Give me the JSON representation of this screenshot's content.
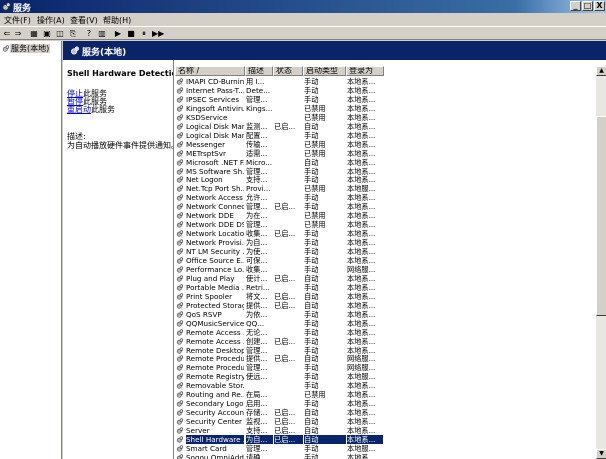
{
  "window": {
    "title": "服务",
    "minimize": "_",
    "maximize": "□",
    "close": "X"
  },
  "menu": [
    "文件(F)",
    "操作(A)",
    "查看(V)",
    "帮助(H)"
  ],
  "toolbar": [
    "⇐",
    "⇒",
    "▦",
    "▣",
    "◫",
    "⎘",
    "?",
    "▥",
    "▶",
    "■",
    "⏸",
    "▶▶"
  ],
  "tree": {
    "root": "服务(本地)"
  },
  "header": {
    "title": "服务(本地)"
  },
  "details": {
    "service_name": "Shell Hardware Detection",
    "actions": [
      {
        "link": "停止",
        "rest": "此服务"
      },
      {
        "link": "暂停",
        "rest": "此服务"
      },
      {
        "link": "重启动",
        "rest": "此服务"
      }
    ],
    "desc_label": "描述:",
    "desc_text": "为自动播放硬件事件提供通知。"
  },
  "columns": [
    "名称 /",
    "描述",
    "状态",
    "启动类型",
    "登录为"
  ],
  "rows": [
    [
      "IMAPI CD-Burnin...",
      "用 I...",
      "",
      "手动",
      "本地系..."
    ],
    [
      "Internet Pass-T...",
      "Dete...",
      "",
      "手动",
      "本地系..."
    ],
    [
      "IPSEC Services",
      "管理...",
      "",
      "手动",
      "本地系..."
    ],
    [
      "Kingsoft Antiviru...",
      "Kings...",
      "",
      "已禁用",
      "本地系..."
    ],
    [
      "KSDService",
      "",
      "",
      "已禁用",
      "本地系..."
    ],
    [
      "Logical Disk Man...",
      "监测...",
      "已启...",
      "自动",
      "本地系..."
    ],
    [
      "Logical Disk Man...",
      "配置...",
      "",
      "手动",
      "本地系..."
    ],
    [
      "Messenger",
      "传输...",
      "",
      "已禁用",
      "本地系..."
    ],
    [
      "METrsptSvr",
      "适需...",
      "",
      "已禁用",
      "本地系..."
    ],
    [
      "Microsoft .NET F...",
      "Micro...",
      "",
      "自动",
      "本地系..."
    ],
    [
      "MS Software Sh...",
      "管理...",
      "",
      "手动",
      "本地系..."
    ],
    [
      "Net Logon",
      "支持...",
      "",
      "手动",
      "本地系..."
    ],
    [
      "Net.Tcp Port Sh...",
      "Provi...",
      "",
      "已禁用",
      "本地服..."
    ],
    [
      "Network Access ...",
      "允许...",
      "",
      "手动",
      "本地系..."
    ],
    [
      "Network Connec...",
      "管理...",
      "已启...",
      "手动",
      "本地系..."
    ],
    [
      "Network DDE",
      "为在...",
      "",
      "已禁用",
      "本地系..."
    ],
    [
      "Network DDE DS...",
      "管理...",
      "",
      "已禁用",
      "本地系..."
    ],
    [
      "Network Locatio...",
      "收集...",
      "已启...",
      "手动",
      "本地系..."
    ],
    [
      "Network Provisi...",
      "为自...",
      "",
      "手动",
      "本地系..."
    ],
    [
      "NT LM Security ...",
      "为使...",
      "",
      "手动",
      "本地系..."
    ],
    [
      "Office Source E...",
      "可保...",
      "",
      "手动",
      "本地系..."
    ],
    [
      "Performance Lo...",
      "收集...",
      "",
      "手动",
      "网络服..."
    ],
    [
      "Plug and Play",
      "使计...",
      "已启...",
      "自动",
      "本地系..."
    ],
    [
      "Portable Media ...",
      "Retri...",
      "",
      "手动",
      "本地系..."
    ],
    [
      "Print Spooler",
      "将文...",
      "已启...",
      "自动",
      "本地系..."
    ],
    [
      "Protected Storage",
      "提供...",
      "已启...",
      "自动",
      "本地系..."
    ],
    [
      "QoS RSVP",
      "为依...",
      "",
      "手动",
      "本地系..."
    ],
    [
      "QQMusicService",
      "QQ...",
      "",
      "手动",
      "本地系..."
    ],
    [
      "Remote Access ...",
      "无论...",
      "",
      "手动",
      "本地系..."
    ],
    [
      "Remote Access ...",
      "创建...",
      "已启...",
      "手动",
      "本地系..."
    ],
    [
      "Remote Desktop...",
      "管理...",
      "",
      "手动",
      "本地系..."
    ],
    [
      "Remote Procedu...",
      "提供...",
      "已启...",
      "自动",
      "网络服..."
    ],
    [
      "Remote Procedu...",
      "管理...",
      "",
      "手动",
      "网络服..."
    ],
    [
      "Remote Registry",
      "使远...",
      "",
      "手动",
      "本地服..."
    ],
    [
      "Removable Stor...",
      "",
      "",
      "手动",
      "本地系..."
    ],
    [
      "Routing and Re...",
      "在局...",
      "",
      "已禁用",
      "本地系..."
    ],
    [
      "Secondary Logon",
      "启用...",
      "",
      "手动",
      "本地系..."
    ],
    [
      "Security Accoun...",
      "存储...",
      "已启...",
      "自动",
      "本地系..."
    ],
    [
      "Security Center",
      "监视...",
      "已启...",
      "自动",
      "本地系..."
    ],
    [
      "Server",
      "支持...",
      "已启...",
      "自动",
      "本地系..."
    ],
    [
      "Shell Hardware ...",
      "为自...",
      "已启...",
      "自动",
      "本地系..."
    ],
    [
      "Smart Card",
      "管理...",
      "",
      "手动",
      "本地服..."
    ],
    [
      "Sogou OmniAdd...",
      "请确...",
      "",
      "手动",
      "本地系..."
    ]
  ],
  "selected_row": 40,
  "colors": {
    "title_bar": "#0a246a",
    "selection": "#0a246a",
    "link": "#0000cc"
  }
}
